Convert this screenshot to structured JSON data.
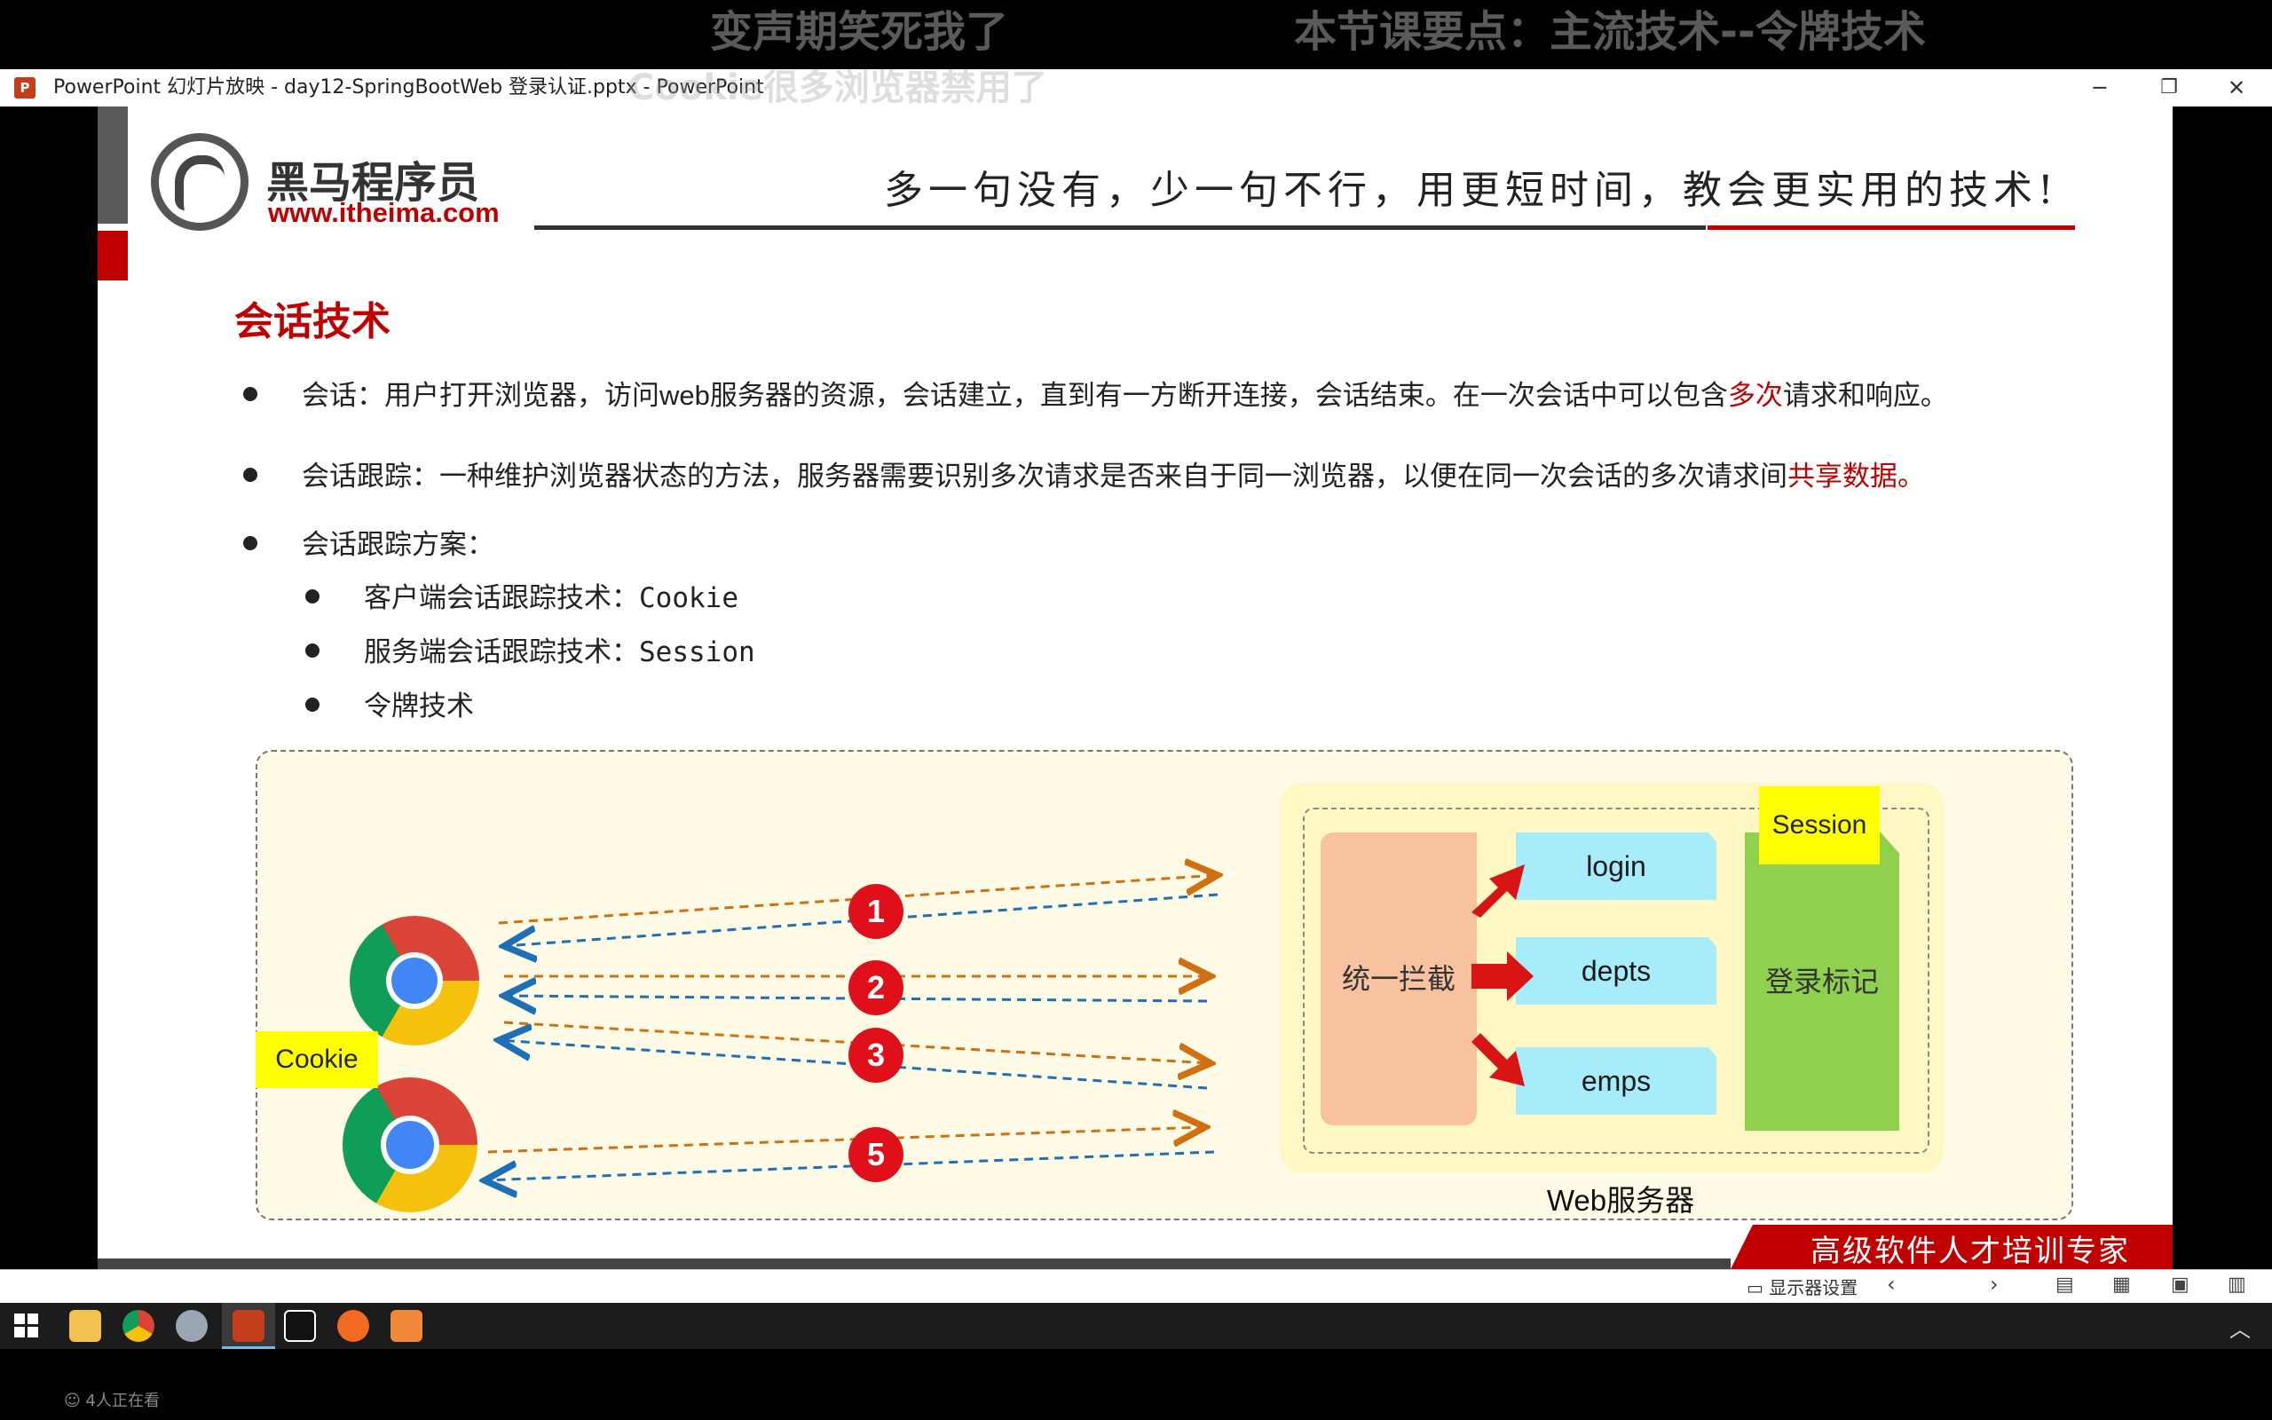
{
  "overlay": {
    "caption_left": "变声期笑死我了",
    "caption_right": "本节课要点：主流技术--令牌技术",
    "faded_caption": "Cookie很多浏览器禁用了"
  },
  "window": {
    "app_icon": "P",
    "title": "PowerPoint 幻灯片放映  -  day12-SpringBootWeb 登录认证.pptx - PowerPoint",
    "minimize": "─",
    "restore": "❐",
    "close": "✕"
  },
  "slide": {
    "logo_name": "黑马程序员",
    "logo_url": "www.itheima.com",
    "slogan": "多一句没有，少一句不行，用更短时间，教会更实用的技术!",
    "heading": "会话技术",
    "bullet1_pre": "会话：用户打开浏览器，访问web服务器的资源，会话建立，直到有一方断开连接，会话结束。在一次会话中可以包含",
    "bullet1_red": "多次",
    "bullet1_post": "请求和响应。",
    "bullet2_pre": "会话跟踪：一种维护浏览器状态的方法，服务器需要识别多次请求是否来自于同一浏览器，以便在同一次会话的多次请求间",
    "bullet2_red": "共享数据。",
    "bullet3": "会话跟踪方案：",
    "sub1": "客户端会话跟踪技术：Cookie",
    "sub2": "服务端会话跟踪技术：Session",
    "sub3": "令牌技术",
    "diagram": {
      "cookie_label": "Cookie",
      "session_label": "Session",
      "interceptor": "统一拦截",
      "login": "login",
      "depts": "depts",
      "emps": "emps",
      "login_flag": "登录标记",
      "server_label": "Web服务器",
      "steps": [
        "1",
        "2",
        "3",
        "5"
      ]
    },
    "footer_banner": "高级软件人才培训专家"
  },
  "status": {
    "display_settings": "显示器设置"
  },
  "footer": {
    "viewers": "4人正在看"
  },
  "colors": {
    "brand_red": "#c00000",
    "arrow_orange": "#d07010",
    "arrow_blue": "#1e6fb5",
    "interceptor_fill": "#f8c2a0",
    "flag_fill": "#8fd14f",
    "endpoint_fill": "#a6ecfb",
    "yellow_tag": "#ffff00"
  }
}
